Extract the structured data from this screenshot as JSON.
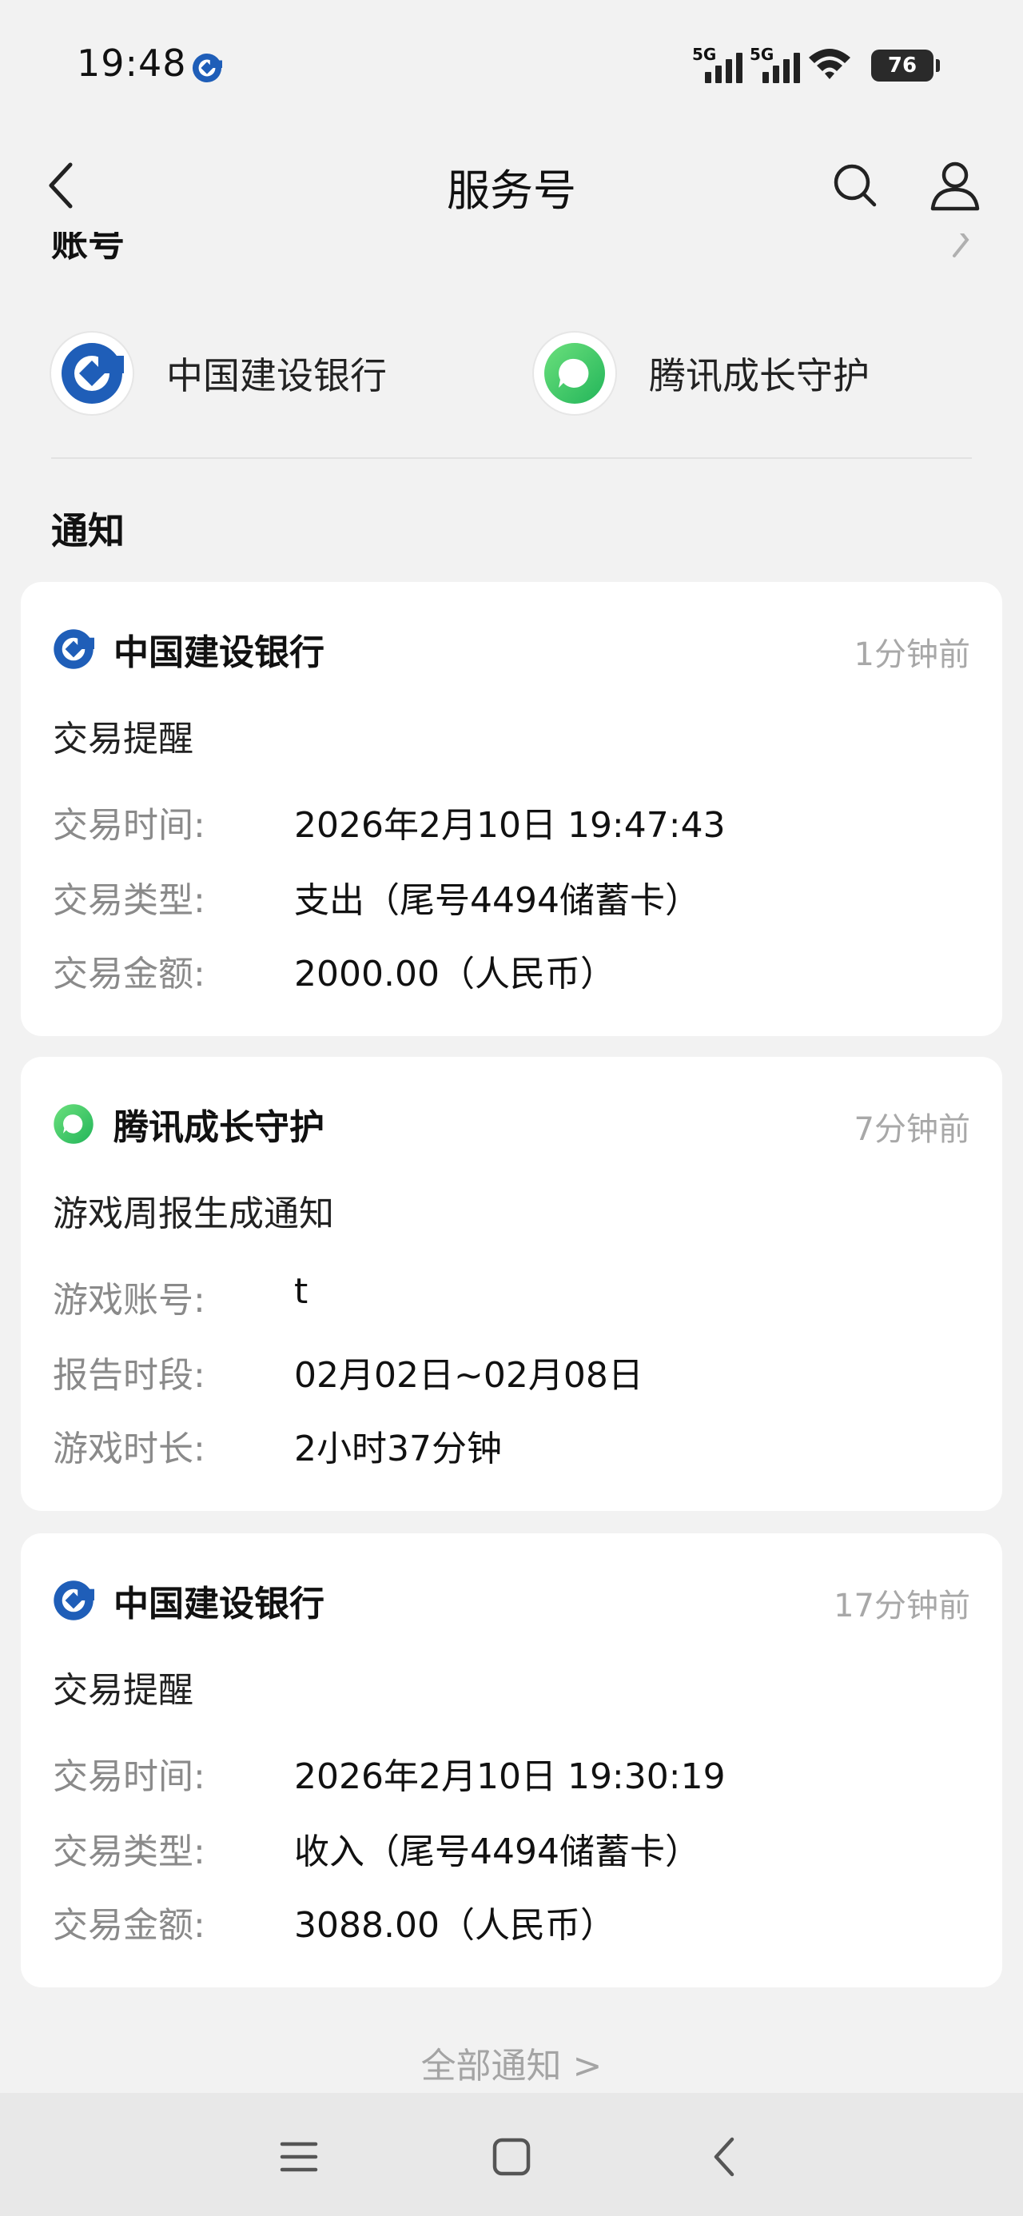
{
  "status_bar": {
    "time": "19:48",
    "network_1": "5G",
    "network_2": "5G",
    "battery": "76"
  },
  "nav": {
    "title": "服务号"
  },
  "section_header_partial": "账号",
  "accounts": [
    {
      "name": "中国建设银行",
      "icon": "ccb-logo-icon"
    },
    {
      "name": "腾讯成长守护",
      "icon": "tencent-growth-logo-icon"
    }
  ],
  "notifications_title": "通知",
  "notifications": [
    {
      "sender": "中国建设银行",
      "time": "1分钟前",
      "subject": "交易提醒",
      "rows": [
        {
          "label": "交易时间:",
          "value": "2026年2月10日 19:47:43"
        },
        {
          "label": "交易类型:",
          "value": "支出（尾号4494储蓄卡）"
        },
        {
          "label": "交易金额:",
          "value": "2000.00（人民币）"
        }
      ]
    },
    {
      "sender": "腾讯成长守护",
      "time": "7分钟前",
      "subject": "游戏周报生成通知",
      "rows": [
        {
          "label": "游戏账号:",
          "value": "t"
        },
        {
          "label": "报告时段:",
          "value": "02月02日~02月08日"
        },
        {
          "label": "游戏时长:",
          "value": "2小时37分钟"
        }
      ]
    },
    {
      "sender": "中国建设银行",
      "time": "17分钟前",
      "subject": "交易提醒",
      "rows": [
        {
          "label": "交易时间:",
          "value": "2026年2月10日 19:30:19"
        },
        {
          "label": "交易类型:",
          "value": "收入（尾号4494储蓄卡）"
        },
        {
          "label": "交易金额:",
          "value": "3088.00（人民币）"
        }
      ]
    }
  ],
  "all_notifications_link": "全部通知 >",
  "colors": {
    "ccb_blue": "#1f5eb8",
    "tencent_green": "#3fcf6a",
    "background": "#f2f2f2"
  }
}
